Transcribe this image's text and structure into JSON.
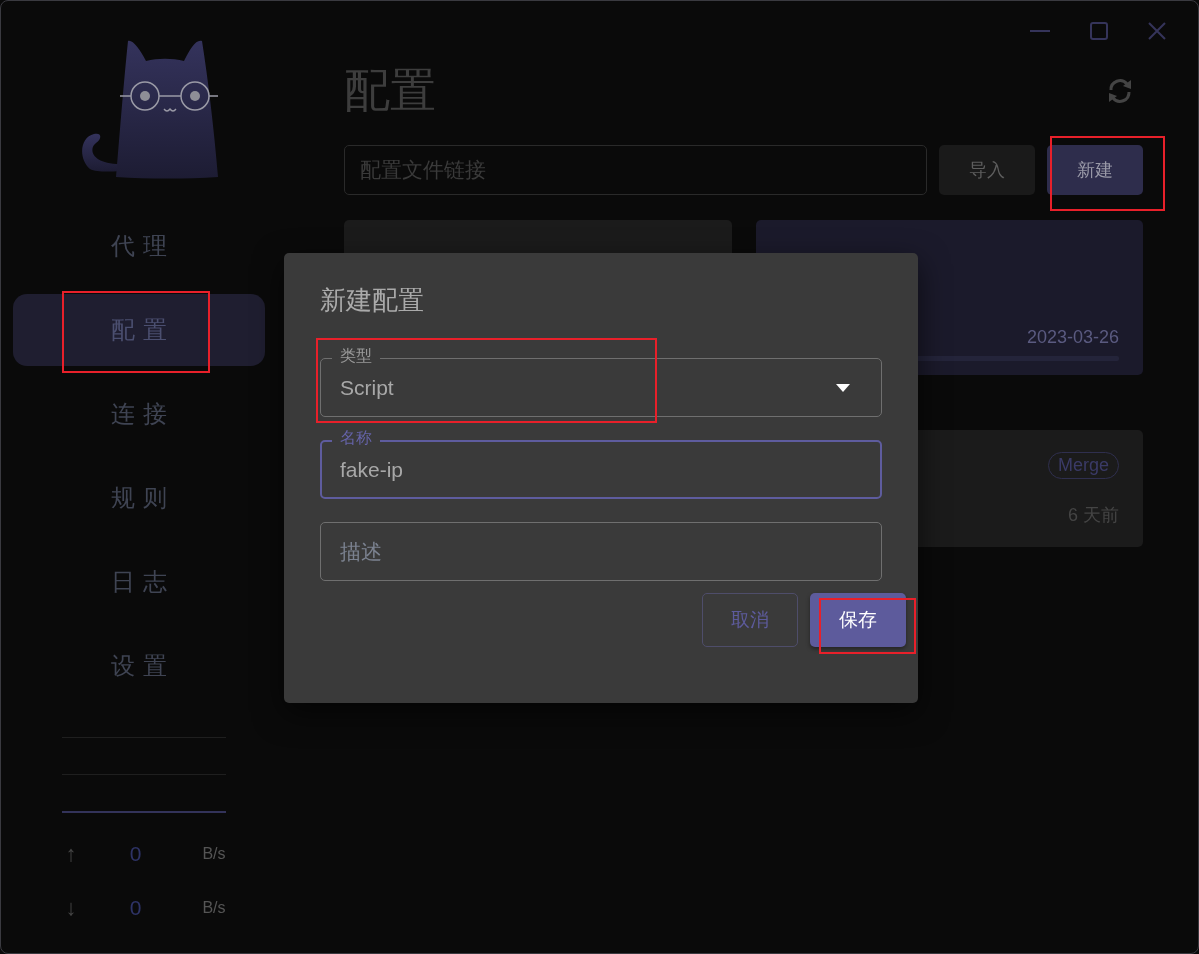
{
  "nav": [
    {
      "label": "代理",
      "selected": false,
      "highlighted": false
    },
    {
      "label": "配置",
      "selected": true,
      "highlighted": true
    },
    {
      "label": "连接",
      "selected": false,
      "highlighted": false
    },
    {
      "label": "规则",
      "selected": false,
      "highlighted": false
    },
    {
      "label": "日志",
      "selected": false,
      "highlighted": false
    },
    {
      "label": "设置",
      "selected": false,
      "highlighted": false
    }
  ],
  "traffic": [
    {
      "arrow": "↑",
      "value": "0",
      "unit": "B/s"
    },
    {
      "arrow": "↓",
      "value": "0",
      "unit": "B/s"
    }
  ],
  "page": {
    "title": "配置"
  },
  "url_field": {
    "placeholder": "配置文件链接"
  },
  "import_button": {
    "label": "导入",
    "disabled": true
  },
  "new_button": {
    "label": "新建",
    "highlighted": true
  },
  "profiles": [
    {
      "selected": false
    },
    {
      "selected": true,
      "date": "2023-03-26"
    }
  ],
  "enhancers": [
    {
      "tag": "Merge",
      "time": "6 天前"
    }
  ],
  "dialog": {
    "title": "新建配置",
    "fields": [
      {
        "kind": "select",
        "label": "类型",
        "value": "Script",
        "focused": false,
        "highlighted": true
      },
      {
        "kind": "text",
        "label": "名称",
        "value": "fake-ip",
        "focused": true,
        "highlighted": false
      },
      {
        "kind": "text",
        "placeholder": "描述",
        "focused": false,
        "highlighted": false
      }
    ],
    "buttons": [
      {
        "label": "取消",
        "kind": "outlined",
        "highlighted": false
      },
      {
        "label": "保存",
        "kind": "primary",
        "highlighted": true
      }
    ]
  }
}
